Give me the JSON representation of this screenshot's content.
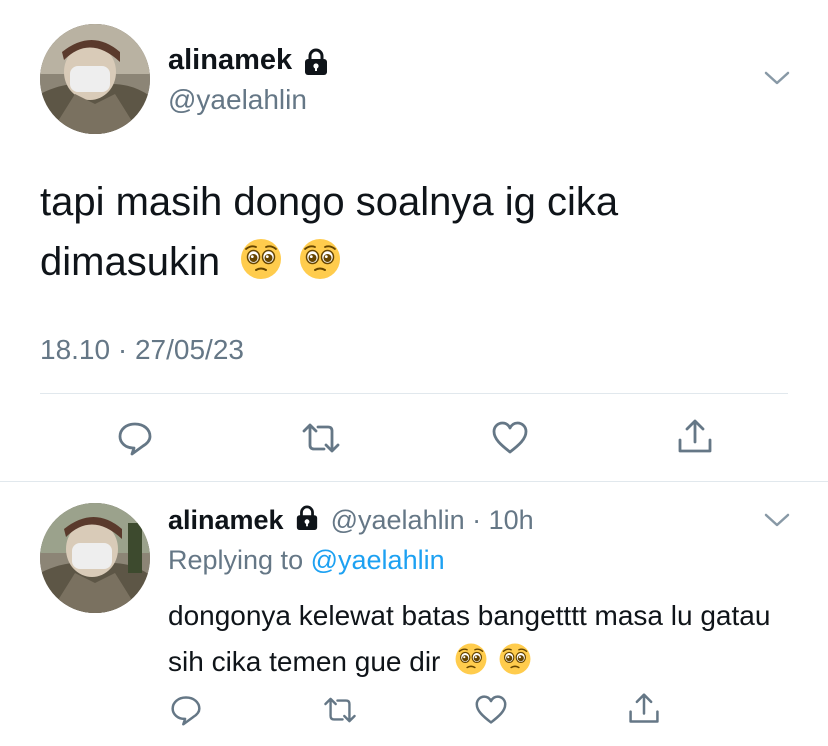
{
  "main_tweet": {
    "display_name": "alinamek",
    "handle": "@yaelahlin",
    "text": "tapi masih dongo soalnya ig cika dimasukin",
    "emojis": [
      "pleading-face",
      "pleading-face"
    ],
    "time": "18.10",
    "separator": "·",
    "date": "27/05/23"
  },
  "reply": {
    "display_name": "alinamek",
    "handle": "@yaelahlin",
    "separator": "·",
    "age": "10h",
    "replying_prefix": "Replying to",
    "replying_to": "@yaelahlin",
    "text": "dongonya kelewat batas bangetttt masa lu gatau sih cika temen gue dir",
    "emojis": [
      "pleading-face",
      "pleading-face"
    ]
  },
  "icons": {
    "lock": "lock-icon",
    "menu": "chevron-down-icon",
    "reply": "comment-icon",
    "retweet": "retweet-icon",
    "like": "heart-icon",
    "share": "share-icon"
  },
  "colors": {
    "text": "#0f1419",
    "secondary": "#657786",
    "link": "#1da1f2",
    "divider": "#e1e8ed",
    "icon": "#657786"
  }
}
